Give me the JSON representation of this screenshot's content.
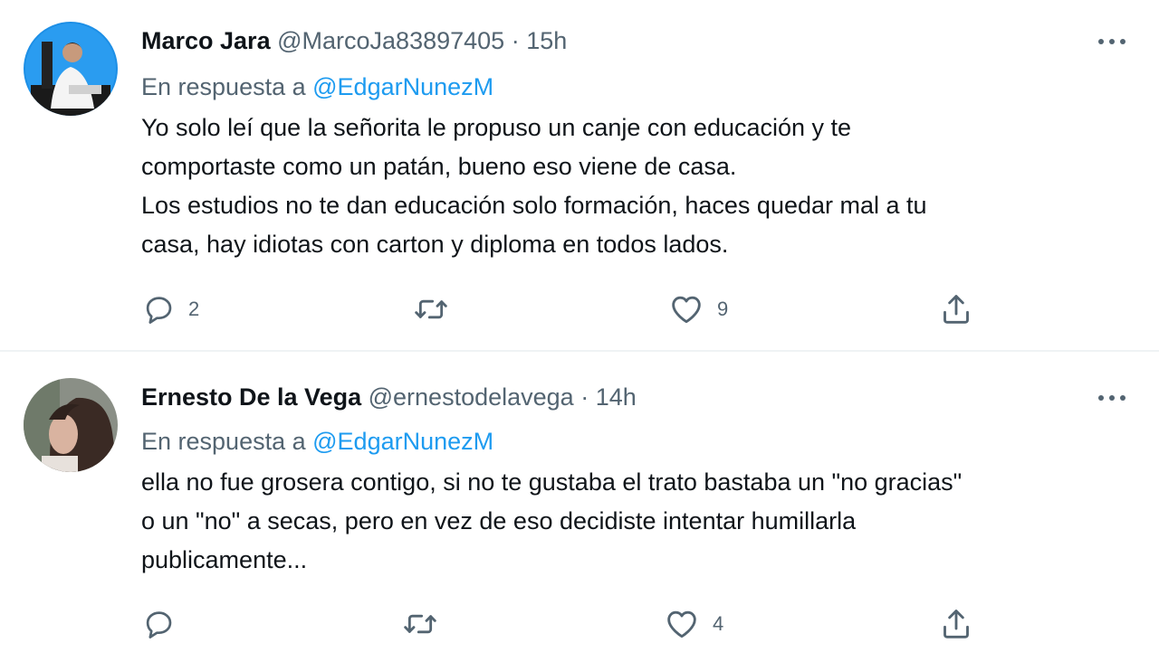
{
  "tweets": [
    {
      "author_name": "Marco Jara",
      "author_handle": "@MarcoJa83897405",
      "separator": "·",
      "time": "15h",
      "reply_prefix": "En respuesta a",
      "reply_to": "@EdgarNunezM",
      "lines": [
        "Yo solo leí que la señorita le propuso un canje con educación y te",
        "comportaste como un patán, bueno eso viene de casa.",
        "Los estudios no te dan educación solo formación, haces quedar mal a tu",
        "casa, hay idiotas con carton y diploma en todos lados."
      ],
      "replies": "2",
      "retweets": "",
      "likes": "9"
    },
    {
      "author_name": "Ernesto De la Vega",
      "author_handle": "@ernestodelavega",
      "separator": "·",
      "time": "14h",
      "reply_prefix": "En respuesta a",
      "reply_to": "@EdgarNunezM",
      "lines": [
        "ella no fue grosera contigo, si no te gustaba el trato bastaba un \"no gracias\"",
        "o un \"no\" a secas, pero en vez de eso decidiste intentar humillarla",
        "publicamente..."
      ],
      "replies": "",
      "retweets": "",
      "likes": "4"
    }
  ],
  "icons": {
    "more": "more-dots-icon",
    "reply": "reply-bubble-icon",
    "retweet": "retweet-icon",
    "like": "heart-icon",
    "share": "share-icon"
  },
  "colors": {
    "text": "#0f1419",
    "secondary": "#536471",
    "mention": "#1d9bf0",
    "divider": "#eff3f4"
  }
}
